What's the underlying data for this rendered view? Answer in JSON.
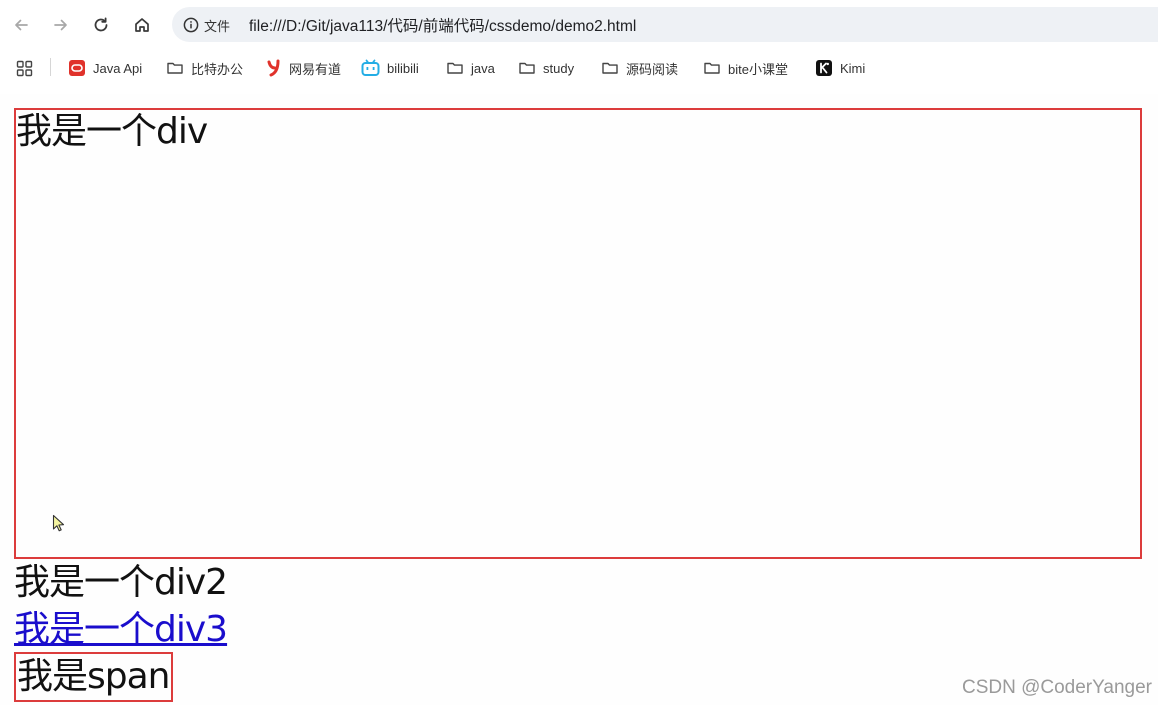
{
  "browser": {
    "address_info_label": "文件",
    "url": "file:///D:/Git/java113/代码/前端代码/cssdemo/demo2.html"
  },
  "bookmarks": [
    {
      "label": "Java Api",
      "icon": "oracle-icon"
    },
    {
      "label": "比特办公",
      "icon": "folder-icon"
    },
    {
      "label": "网易有道",
      "icon": "youdao-icon"
    },
    {
      "label": "bilibili",
      "icon": "bilibili-icon"
    },
    {
      "label": "java",
      "icon": "folder-icon"
    },
    {
      "label": "study",
      "icon": "folder-icon"
    },
    {
      "label": "源码阅读",
      "icon": "folder-icon"
    },
    {
      "label": "bite小课堂",
      "icon": "folder-icon"
    },
    {
      "label": "Kimi",
      "icon": "kimi-icon"
    }
  ],
  "page": {
    "div1_text": "我是一个div",
    "div2_text": "我是一个div2",
    "div3_text": "我是一个div3",
    "span_text": "我是span"
  },
  "watermark": "CSDN @CoderYanger",
  "colors": {
    "border_red": "#dc3c3c",
    "link_blue": "#1a0dcc"
  }
}
